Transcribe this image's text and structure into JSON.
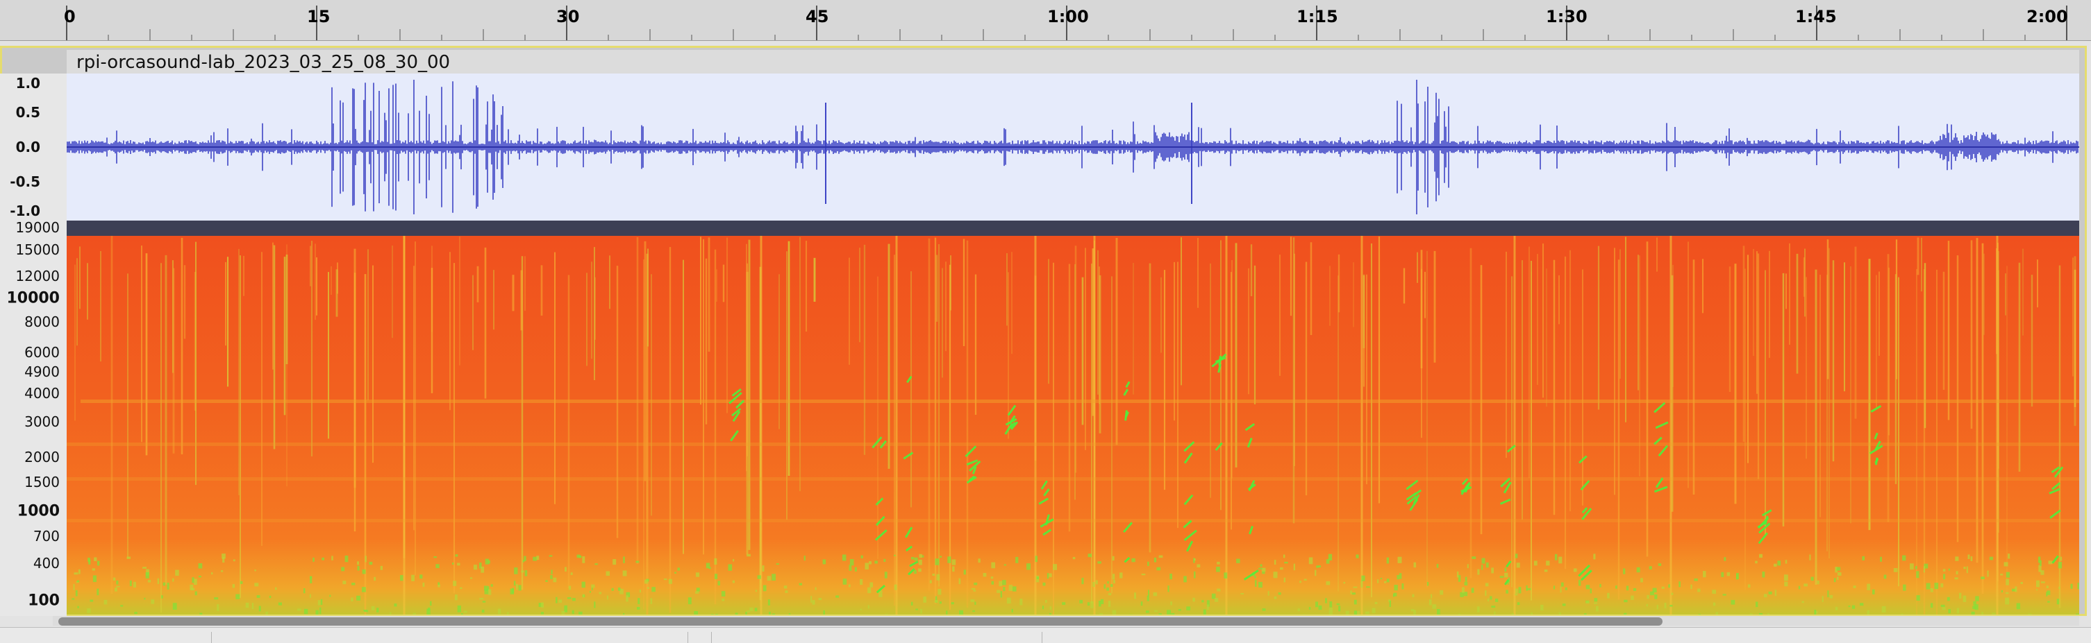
{
  "ruler": {
    "labels": [
      "0",
      "15",
      "30",
      "45",
      "1:00",
      "1:15",
      "1:30",
      "1:45",
      "2:00"
    ]
  },
  "track": {
    "name": "rpi-orcasound-lab_2023_03_25_08_30_00"
  },
  "waveform_scale": {
    "labels": [
      "1.0",
      "0.5",
      "0.0",
      "-0.5",
      "-1.0"
    ]
  },
  "spectrogram_scale": {
    "labels": [
      "19000",
      "15000",
      "12000",
      "10000",
      "8000",
      "6000",
      "4900",
      "4000",
      "3000",
      "2000",
      "1500",
      "1000",
      "700",
      "400",
      "100"
    ]
  },
  "colors": {
    "waveform": "#3f45c6",
    "waveform_bg": "#e6ebfb",
    "spectrogram_hot": "#f0501e",
    "spectrogram_mid": "#f59a2c",
    "spectrogram_green": "#4ef03c",
    "track_selected_border": "#e5dc6e"
  }
}
